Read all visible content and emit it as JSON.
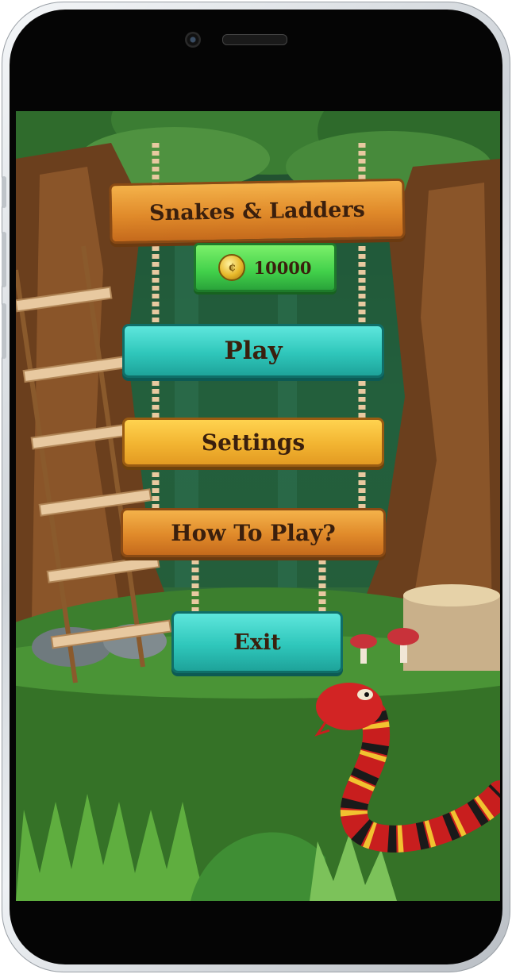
{
  "game": {
    "title": "Snakes & Ladders",
    "coins": "10000",
    "menu": {
      "play_label": "Play",
      "settings_label": "Settings",
      "how_to_play_label": "How To Play?",
      "exit_label": "Exit"
    }
  },
  "icons": {
    "coin": "coin-icon",
    "snake": "snake-illustration",
    "ladder": "ladder-illustration"
  },
  "colors": {
    "title_sign": "#e08a2a",
    "coin_sign": "#41d04a",
    "play_sign": "#2fc7bb",
    "settings_sign": "#f2b431",
    "how_to_play_sign": "#e08a2a",
    "exit_sign": "#2fc7bb",
    "text": "#3a1f0d"
  }
}
